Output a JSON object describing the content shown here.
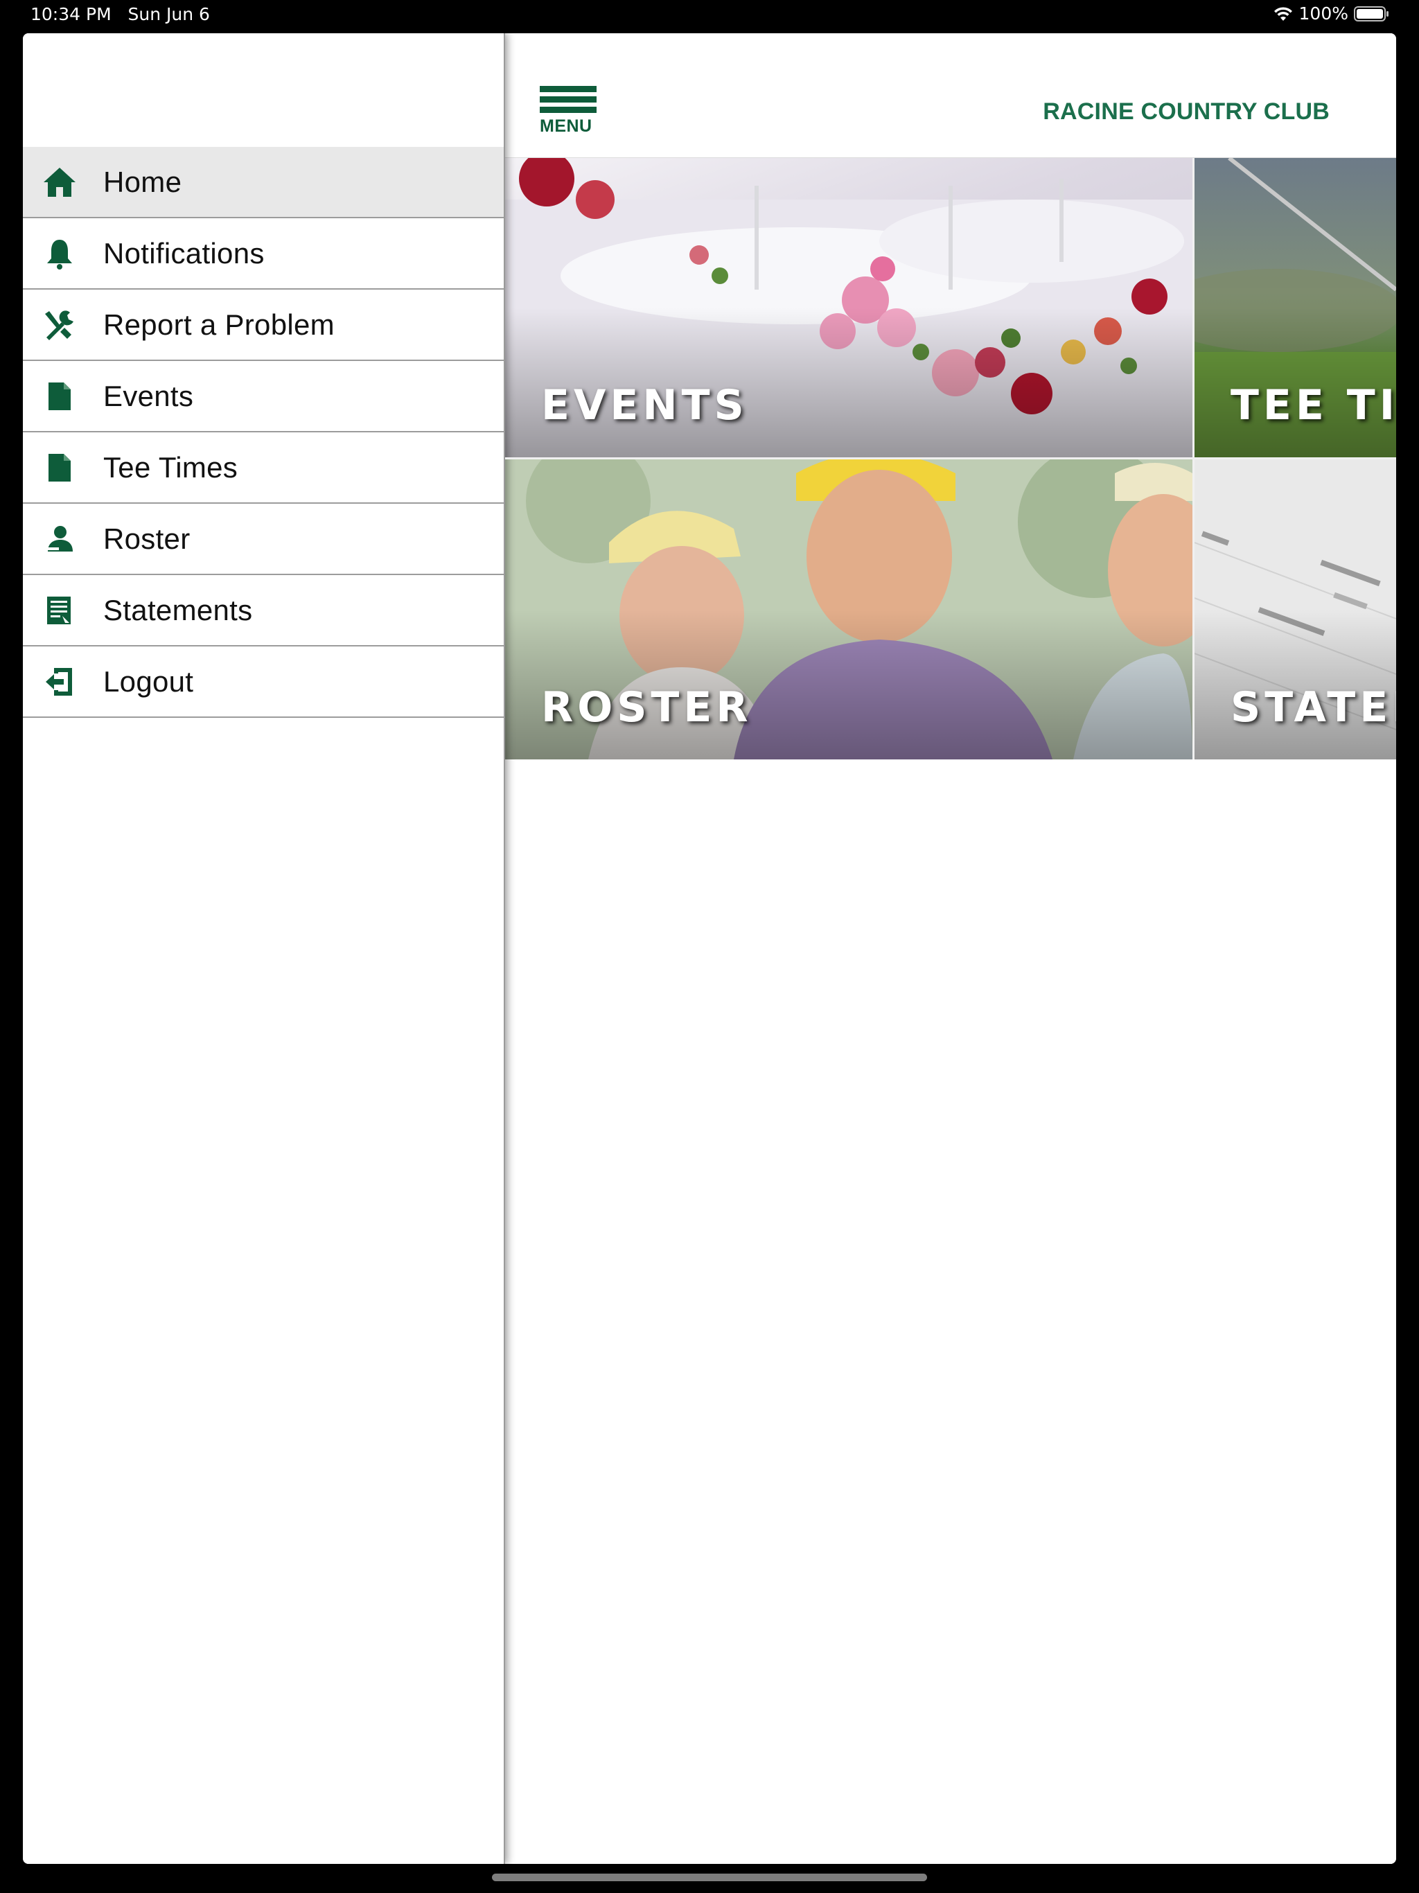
{
  "status_bar": {
    "time": "10:34 PM",
    "date": "Sun Jun 6",
    "battery": "100%"
  },
  "drawer": {
    "items": [
      {
        "label": "Home",
        "icon": "home-icon"
      },
      {
        "label": "Notifications",
        "icon": "bell-icon"
      },
      {
        "label": "Report a Problem",
        "icon": "tools-icon"
      },
      {
        "label": "Events",
        "icon": "document-icon"
      },
      {
        "label": "Tee Times",
        "icon": "document-icon"
      },
      {
        "label": "Roster",
        "icon": "person-icon"
      },
      {
        "label": "Statements",
        "icon": "statement-icon"
      },
      {
        "label": "Logout",
        "icon": "logout-icon"
      }
    ],
    "active_index": 0
  },
  "header": {
    "menu_label": "MENU",
    "club_name": "RACINE COUNTRY CLUB"
  },
  "tiles": [
    {
      "label": "EVENTS"
    },
    {
      "label": "TEE TIMES"
    },
    {
      "label": "ROSTER"
    },
    {
      "label": "STATEMENTS"
    }
  ],
  "colors": {
    "brand_green": "#0e5c3a",
    "club_name_green": "#1b6f4c",
    "active_item_bg": "#e8e8e8"
  }
}
